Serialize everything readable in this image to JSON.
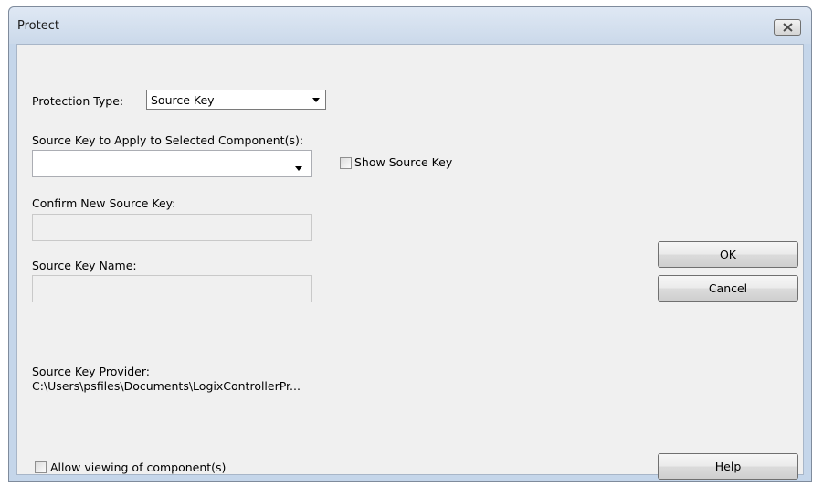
{
  "window": {
    "title": "Protect",
    "close_icon": "close-x-icon"
  },
  "protection_type": {
    "label": "Protection Type:",
    "selected": "Source Key"
  },
  "source_key": {
    "label": "Source Key to Apply to Selected Component(s):",
    "value": ""
  },
  "show_source_key": {
    "label": "Show Source Key",
    "checked": false
  },
  "confirm_key": {
    "label": "Confirm New Source Key:",
    "value": ""
  },
  "key_name": {
    "label": "Source Key Name:",
    "value": ""
  },
  "provider": {
    "label": "Source Key Provider:",
    "path": "C:\\Users\\psfiles\\Documents\\LogixControllerPr..."
  },
  "allow_viewing": {
    "label": "Allow viewing of component(s)",
    "checked": false
  },
  "buttons": {
    "ok": "OK",
    "cancel": "Cancel",
    "help": "Help"
  }
}
